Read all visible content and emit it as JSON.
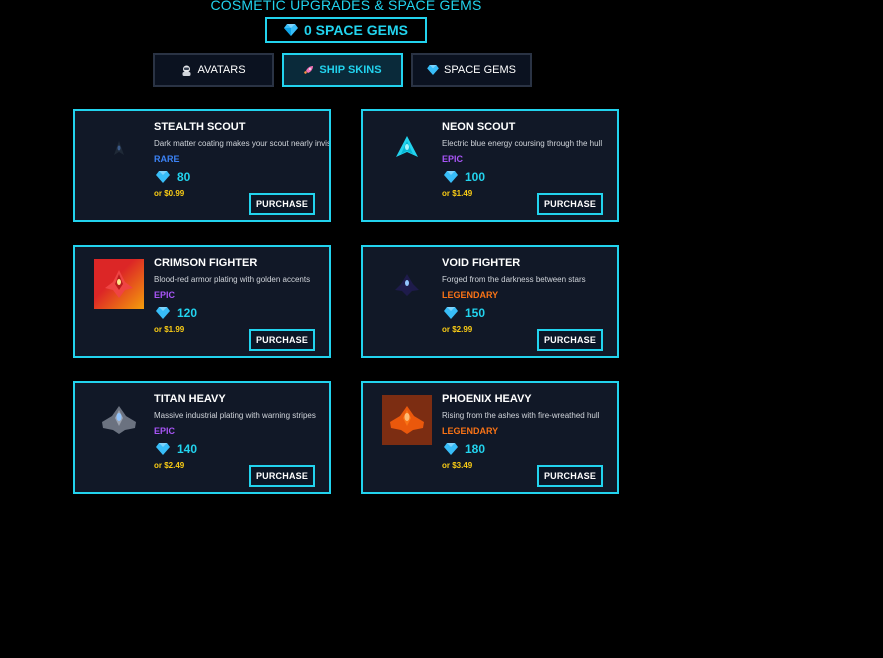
{
  "header": {
    "title": "COSMETIC UPGRADES & SPACE GEMS",
    "gems_balance": "0 SPACE GEMS"
  },
  "tabs": [
    {
      "label": "AVATARS",
      "icon": "astronaut-icon",
      "active": false
    },
    {
      "label": "SHIP SKINS",
      "icon": "rocket-icon",
      "active": true
    },
    {
      "label": "SPACE GEMS",
      "icon": "gem-icon",
      "active": false
    }
  ],
  "colors": {
    "accent": "#22d3ee",
    "rare": "#3b82f6",
    "epic": "#a855f7",
    "legendary": "#f97316",
    "alt_price": "#facc15"
  },
  "products": [
    {
      "name": "STEALTH SCOUT",
      "description": "Dark matter coating makes your scout nearly invisible",
      "rarity": "RARE",
      "price": "80",
      "alt_price": "or $0.99",
      "button": "PURCHASE",
      "icon": "stealth-ship-icon"
    },
    {
      "name": "NEON SCOUT",
      "description": "Electric blue energy coursing through the hull",
      "rarity": "EPIC",
      "price": "100",
      "alt_price": "or $1.49",
      "button": "PURCHASE",
      "icon": "neon-ship-icon"
    },
    {
      "name": "CRIMSON FIGHTER",
      "description": "Blood-red armor plating with golden accents",
      "rarity": "EPIC",
      "price": "120",
      "alt_price": "or $1.99",
      "button": "PURCHASE",
      "icon": "crimson-ship-icon"
    },
    {
      "name": "VOID FIGHTER",
      "description": "Forged from the darkness between stars",
      "rarity": "LEGENDARY",
      "price": "150",
      "alt_price": "or $2.99",
      "button": "PURCHASE",
      "icon": "void-ship-icon"
    },
    {
      "name": "TITAN HEAVY",
      "description": "Massive industrial plating with warning stripes",
      "rarity": "EPIC",
      "price": "140",
      "alt_price": "or $2.49",
      "button": "PURCHASE",
      "icon": "titan-ship-icon"
    },
    {
      "name": "PHOENIX HEAVY",
      "description": "Rising from the ashes with fire-wreathed hull",
      "rarity": "LEGENDARY",
      "price": "180",
      "alt_price": "or $3.49",
      "button": "PURCHASE",
      "icon": "phoenix-ship-icon"
    }
  ]
}
